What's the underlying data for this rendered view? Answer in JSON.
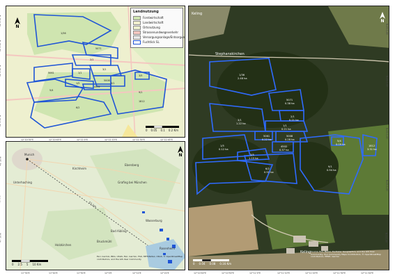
{
  "top_map": {
    "legend": {
      "title": "Landnutzung",
      "items": [
        {
          "label": "Forstwirtschaft",
          "color": "#cfe5b0"
        },
        {
          "label": "Landwirtschaft",
          "color": "#f2f0cf"
        },
        {
          "label": "Ortsnutzung",
          "color": "#eef0cf"
        },
        {
          "label": "Strassenundwegeverkehr",
          "color": "#f4c7c0"
        },
        {
          "label": "Versorgungsanlage/Entsorgung",
          "color": "#e8e8e8"
        },
        {
          "label": "Fuchtlick SL",
          "color": "#1f55d6"
        }
      ]
    },
    "north": "N",
    "scale": {
      "ticks": [
        "0",
        "0.05",
        "0.1",
        "0.2 Km"
      ]
    },
    "parcel_labels": [
      "1/36",
      "5071",
      "2/1",
      "3/1",
      "1/1",
      "5061",
      "5008",
      "1/5",
      "4502",
      "3/5",
      "5/4",
      "6/2",
      "9/1",
      "3/1",
      "1812"
    ]
  },
  "overview_map": {
    "places": [
      "Munich",
      "Unterhaching",
      "Kirchheim",
      "Ebersberg",
      "Grafing bei München",
      "Rosenheim",
      "Bad Aibling",
      "Wasserburg",
      "Bruckmühl",
      "Holzkirchen"
    ],
    "distance_label": "51 km",
    "north": "N",
    "scale": {
      "ticks": [
        "0",
        "2.5",
        "5",
        "10 Km"
      ]
    },
    "attribution": "Esri, Garmin, BKG, USGS, Esri, Garmin, FAO, METI/NASA, USGS, © OpenStreetMap contributors, and the GIS User Community"
  },
  "right_map": {
    "place_top": "Keling",
    "place_mid": "Stephanskirchen",
    "place_bottom": "Keling",
    "north": "N",
    "scale": {
      "ticks": [
        "0",
        "0.04",
        "0.08",
        "0.16 Km"
      ]
    },
    "attribution": "Source: Esri, Maxar, Earthstar Geographics, and the GIS User Community, Esri Community Maps Contributors, © OpenStreetMap contributors, HERE, Garmin",
    "parcel_labels": [
      {
        "id": "1/36",
        "area": "2.48 ha"
      },
      {
        "id": "5071",
        "area": "0.38 ha"
      },
      {
        "id": "2/1",
        "area": "0.21 ha"
      },
      {
        "id": "3/1",
        "area": "1.22 ha"
      },
      {
        "id": "1/1",
        "area": "0.21 ha"
      },
      {
        "id": "5061",
        "area": "0.22 ha"
      },
      {
        "id": "5008",
        "area": "0.28 ha"
      },
      {
        "id": "1/5",
        "area": "0.12 ha"
      },
      {
        "id": "4502",
        "area": "0.37 ha"
      },
      {
        "id": "3/5",
        "area": "1.15 ha"
      },
      {
        "id": "5/4",
        "area": "0.09 ha"
      },
      {
        "id": "6/2",
        "area": "0.51 ha"
      },
      {
        "id": "9/1",
        "area": "0.94 ha"
      },
      {
        "id": "1812",
        "area": "3.31 ha"
      }
    ]
  },
  "coords": {
    "top_x": [
      "12°10'30\"E",
      "12°10'45\"E",
      "12°11'0\"E",
      "12°11'15\"E",
      "12°11'30\"E",
      "12°11'45\"E"
    ],
    "top_y": [
      "48°2'30\"N",
      "48°2'20\"N",
      "48°2'10\"N",
      "48°2'0\"N",
      "48°1'50\"N"
    ],
    "bottom_x": [
      "11°30'E",
      "11°40'E",
      "11°50'E",
      "12°0'E",
      "12°10'E",
      "12°20'E"
    ],
    "bottom_y": [
      "48°10'N",
      "48°0'N",
      "47°50'N"
    ],
    "right_x": [
      "12°10'40\"E",
      "12°10'50\"E",
      "12°11'0\"E",
      "12°11'10\"E",
      "12°11'20\"E",
      "12°11'30\"E",
      "12°11'40\"E"
    ],
    "right_y": [
      "48°2'40\"N",
      "48°2'30\"N",
      "48°2'20\"N",
      "48°2'10\"N",
      "48°2'0\"N"
    ]
  },
  "colors": {
    "parcel_outline": "#1f55d6",
    "forest": "#cfe5b0",
    "farmland": "#f2f0cf",
    "road": "#f4c7c0"
  }
}
